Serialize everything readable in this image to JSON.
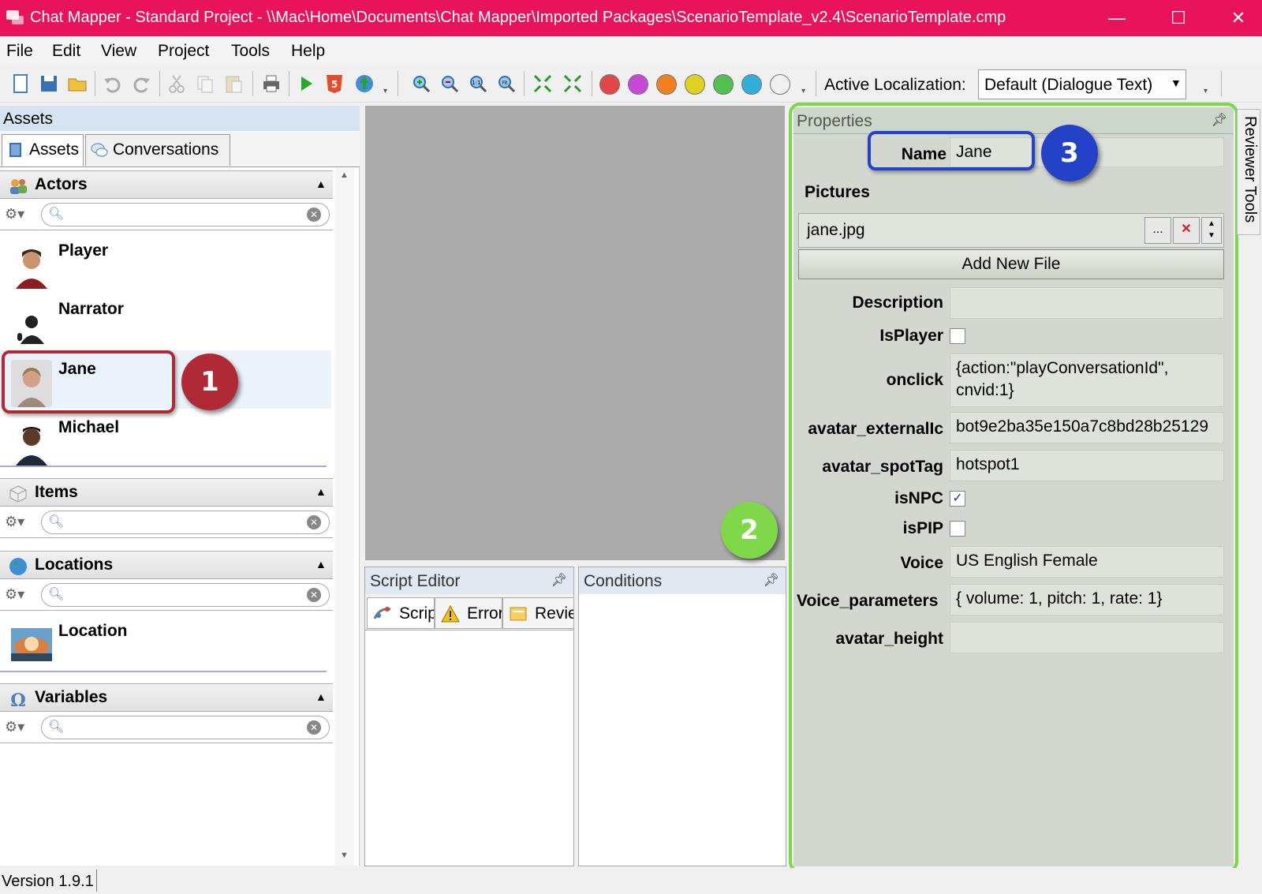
{
  "window": {
    "title": "Chat Mapper - Standard Project - \\\\Mac\\Home\\Documents\\Chat Mapper\\Imported Packages\\ScenarioTemplate_v2.4\\ScenarioTemplate.cmp",
    "titlebar_color": "#e8135a"
  },
  "menu": [
    "File",
    "Edit",
    "View",
    "Project",
    "Tools",
    "Help"
  ],
  "toolbar": {
    "localization_label": "Active Localization:",
    "localization_value": "Default (Dialogue Text)",
    "color_swatches": [
      "#e04848",
      "#c848d8",
      "#f08020",
      "#e0d020",
      "#50c050",
      "#30b0d8",
      "#f0f0f0"
    ]
  },
  "assets": {
    "header": "Assets",
    "tabs": [
      "Assets",
      "Conversations"
    ],
    "sections": {
      "actors": {
        "title": "Actors",
        "items": [
          "Player",
          "Narrator",
          "Jane",
          "Michael"
        ]
      },
      "items": {
        "title": "Items"
      },
      "locations": {
        "title": "Locations",
        "items": [
          "Location"
        ]
      },
      "variables": {
        "title": "Variables"
      }
    }
  },
  "script_editor": {
    "title": "Script Editor",
    "tabs": [
      "Scrip",
      "Error",
      "Revie"
    ]
  },
  "conditions": {
    "title": "Conditions"
  },
  "properties": {
    "title": "Properties",
    "name_label": "Name",
    "name_value": "Jane",
    "pictures_label": "Pictures",
    "picture_file": "jane.jpg",
    "browse_label": "...",
    "add_file_label": "Add New File",
    "fields": {
      "description_label": "Description",
      "description_value": "",
      "isplayer_label": "IsPlayer",
      "isplayer_checked": false,
      "onclick_label": "onclick",
      "onclick_line1": "{action:\"playConversationId\",",
      "onclick_line2": "cnvid:1}",
      "avatar_external_label": "avatar_externalIc",
      "avatar_external_value": "bot9e2ba35e150a7c8bd28b25129",
      "avatar_spottag_label": "avatar_spotTag",
      "avatar_spottag_value": "hotspot1",
      "isnpc_label": "isNPC",
      "isnpc_checked": true,
      "ispip_label": "isPIP",
      "ispip_checked": false,
      "voice_label": "Voice",
      "voice_value": "US English Female",
      "voice_params_label": "Voice_parameters",
      "voice_params_value": "{ volume: 1, pitch: 1, rate: 1}",
      "avatar_height_label": "avatar_height",
      "avatar_height_value": ""
    }
  },
  "reviewer_tab": "Reviewer Tools",
  "status": {
    "version": "Version 1.9.1"
  },
  "callouts": {
    "one": {
      "number": "1",
      "color": "#b02a36"
    },
    "two": {
      "number": "2",
      "color": "#7ed84a"
    },
    "three": {
      "number": "3",
      "color": "#2442c8"
    }
  }
}
